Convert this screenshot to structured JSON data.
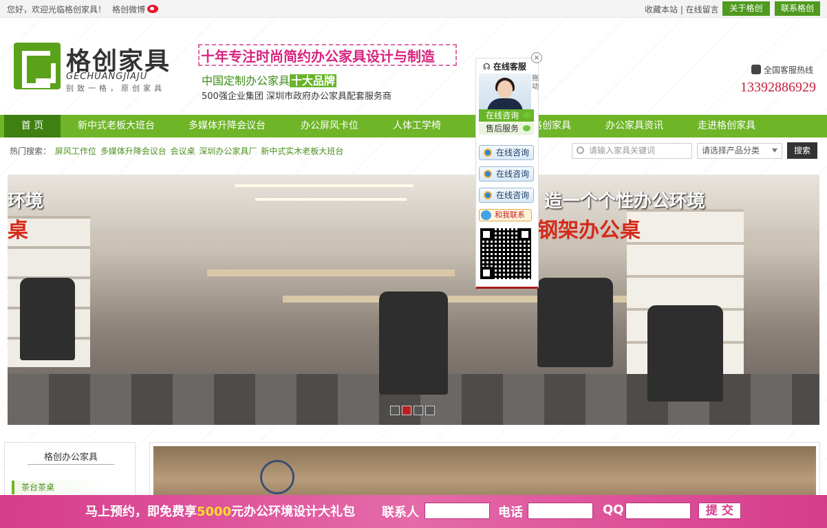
{
  "colors": {
    "brand_green": "#6eb528",
    "nav_active": "#3f8012",
    "accent_pink": "#d63c8c",
    "hotline_red": "#c41e3a"
  },
  "topbar": {
    "welcome": "您好，欢迎光临格创家具！",
    "weibo": "格创微博",
    "links": "收藏本站 | 在线留言",
    "about_btn": "关于格创",
    "contact_btn": "联系格创"
  },
  "header": {
    "brand_cn": "格创家具",
    "brand_en": "GECHUANGJIAJU",
    "brand_slogan": "别致一格，原创家具",
    "tagline": "十年专注时尚简约办公家具设计与制造",
    "line2_prefix": "中国定制办公家具",
    "line2_highlight": "十大品牌",
    "line3": "500强企业集团 深圳市政府办公家具配套服务商",
    "hotline_label": "全国客服热线",
    "hotline_number": "13392886929"
  },
  "nav": [
    "首 页",
    "新中式老板大班台",
    "多媒体升降会议台",
    "办公屏风卡位",
    "人体工学椅",
    "格创家具",
    "办公家具资讯",
    "走进格创家具"
  ],
  "search": {
    "hot_label": "热门搜索：",
    "hot_words": [
      "屏风工作位",
      "多媒体升降会议台",
      "会议桌",
      "深圳办公家具厂",
      "新中式实木老板大班台"
    ],
    "placeholder": "请输入家具关键词",
    "category": "请选择产品分类",
    "button": "搜索"
  },
  "banner": {
    "text_right_1": "造一个个性办公环境",
    "text_right_2": "钢架办公桌",
    "text_left_1": "环境",
    "text_left_2": "桌",
    "slides_total": 4,
    "slide_active": 2
  },
  "sidebar": {
    "title": "格创办公家具",
    "item": "茶台茶桌"
  },
  "service": {
    "title": "在线客服",
    "drag": "拖动",
    "online": "在线咨询",
    "after_sale": "售后服务",
    "qq": [
      "在线咨询",
      "在线咨询",
      "在线咨询"
    ],
    "chat": "和我联系"
  },
  "promo": {
    "text_prefix": "马上预约，即免费享",
    "text_amount": "5000",
    "text_suffix": "元办公环境设计大礼包",
    "contact_label": "联系人",
    "phone_label": "电话",
    "qq_label": "QQ",
    "submit": "提 交"
  }
}
